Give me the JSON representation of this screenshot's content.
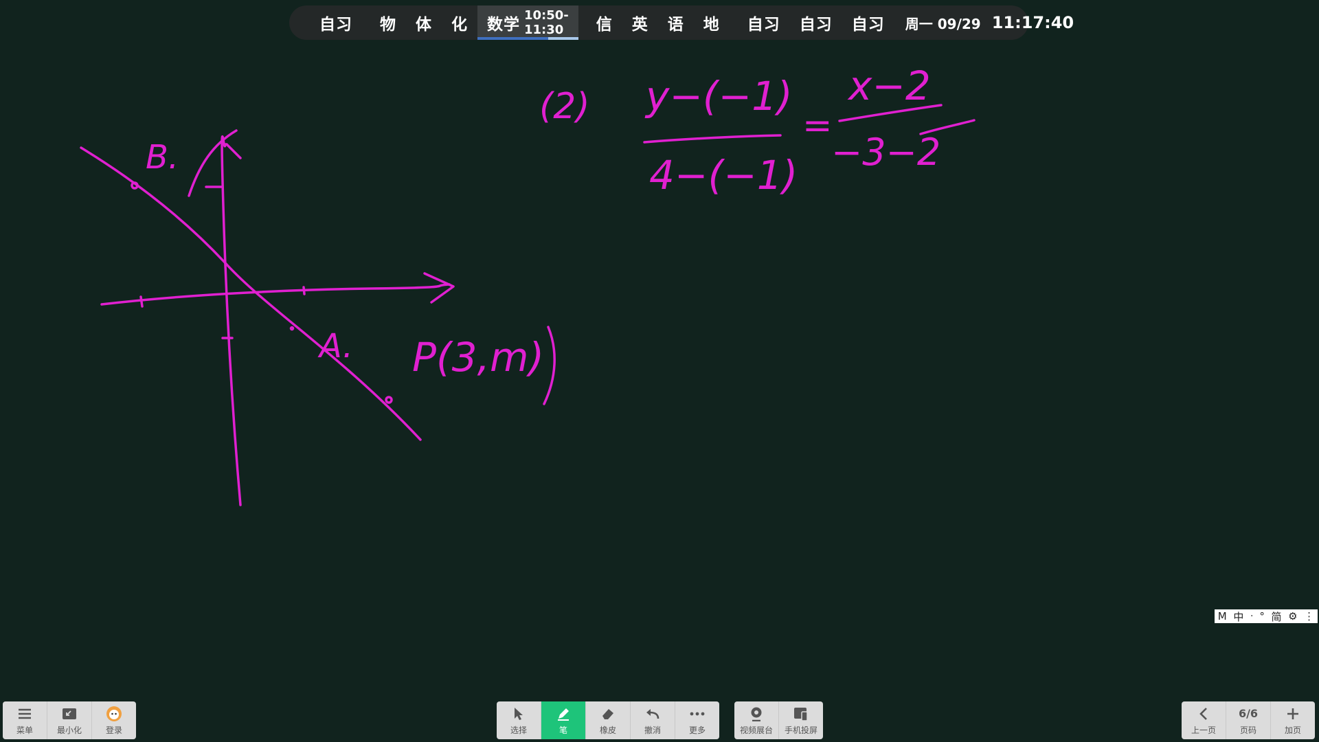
{
  "schedule": {
    "items_a": [
      "自习"
    ],
    "items_b": [
      "物",
      "体",
      "化"
    ],
    "current": {
      "subject": "数学",
      "time": "10:50-11:30",
      "progress": 0.7
    },
    "items_c": [
      "信",
      "英",
      "语",
      "地"
    ],
    "items_d": [
      "自习",
      "自习",
      "自习"
    ],
    "date": "周一 09/29",
    "clock": "11:17:40"
  },
  "board": {
    "ink_color": "#e020d0",
    "labels": {
      "b": "B.",
      "a": "A.",
      "p": "P(3,m)",
      "eq_prefix": "(2)",
      "eq_top_left": "y−(−1)",
      "eq_bottom_left": "4−(−1)",
      "eq_equals": "=",
      "eq_top_right": "x−2",
      "eq_bottom_right": "−3−2"
    }
  },
  "left_toolbar": [
    {
      "label": "菜单",
      "icon": "menu-icon"
    },
    {
      "label": "最小化",
      "icon": "minimize-icon"
    },
    {
      "label": "登录",
      "icon": "avatar-icon"
    }
  ],
  "center_toolbar": [
    {
      "label": "选择",
      "icon": "cursor-icon"
    },
    {
      "label": "笔",
      "icon": "pen-icon",
      "active": true
    },
    {
      "label": "橡皮",
      "icon": "eraser-icon"
    },
    {
      "label": "撤消",
      "icon": "undo-icon"
    },
    {
      "label": "更多",
      "icon": "more-icon"
    }
  ],
  "center_toolbar2": [
    {
      "label": "视频展台",
      "icon": "camera-icon"
    },
    {
      "label": "手机投屏",
      "icon": "phone-cast-icon"
    }
  ],
  "right_toolbar": {
    "prev_label": "上一页",
    "page_value": "6/6",
    "page_label": "页码",
    "add_label": "加页"
  },
  "ime": {
    "chars": [
      "M",
      "中",
      "ᐧ",
      "°",
      "简",
      "⚙",
      "⋮"
    ]
  },
  "colors": {
    "accent": "#1ec47a",
    "background": "#11231e",
    "ink": "#e020d0"
  }
}
